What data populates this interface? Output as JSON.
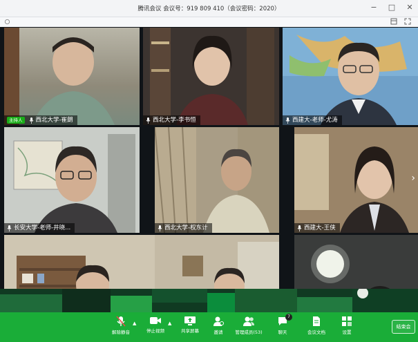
{
  "window": {
    "title": "腾讯会议 会议号：919 809 410（会议密码：2020）",
    "controls": [
      "−",
      "□",
      "✕"
    ]
  },
  "participants": [
    {
      "name": "西北大学-崔朗",
      "is_host": true,
      "host_label": "主持人"
    },
    {
      "name": "西北大学-李书恒",
      "is_host": false
    },
    {
      "name": "西建大-老师-尤涛",
      "is_host": false
    },
    {
      "name": "长安大学-老师-井晓...",
      "is_host": false
    },
    {
      "name": "西北大学-权东计",
      "is_host": false
    },
    {
      "name": "西建大-王侠",
      "is_host": false
    },
    {
      "name": "",
      "is_host": false
    },
    {
      "name": "",
      "is_host": false
    },
    {
      "name": "",
      "is_host": false
    }
  ],
  "grid_nav": {
    "next_icon": "chevron-right-icon"
  },
  "toolbar": {
    "items": [
      {
        "label": "解除静音",
        "icon": "microphone-muted-icon"
      },
      {
        "label": "停止视频",
        "icon": "video-camera-icon"
      },
      {
        "label": "共享屏幕",
        "icon": "share-screen-icon"
      },
      {
        "label": "邀请",
        "icon": "invite-person-icon"
      },
      {
        "label": "管理成员(53)",
        "icon": "members-icon"
      },
      {
        "label": "聊天",
        "icon": "chat-icon",
        "badge": "7"
      },
      {
        "label": "会议文档",
        "icon": "document-icon"
      },
      {
        "label": "设置",
        "icon": "settings-grid-icon"
      }
    ],
    "end_label": "结束会"
  },
  "colors": {
    "toolbar_bg": "#1aad38",
    "host_badge": "#1aad19"
  }
}
